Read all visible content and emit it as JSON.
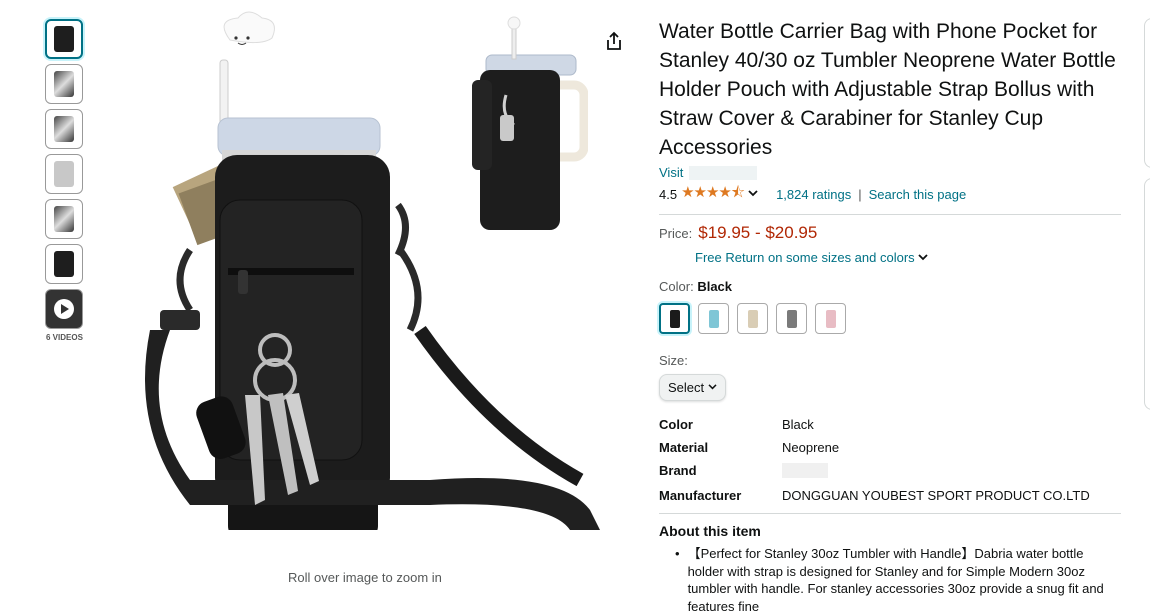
{
  "gallery": {
    "videos_label": "6 VIDEOS",
    "zoom_hint": "Roll over image to zoom in"
  },
  "product": {
    "title": "Water Bottle Carrier Bag with Phone Pocket for Stanley 40/30 oz Tumbler Neoprene Water Bottle Holder Pouch with Adjustable Strap Bollus with Straw Cover & Carabiner for Stanley Cup Accessories",
    "visit_label": "Visit",
    "rating_value": "4.5",
    "stars": "★★★★⯪",
    "ratings_count": "1,824 ratings",
    "search_page": "Search this page",
    "price_label": "Price:",
    "price": "$19.95 - $20.95",
    "free_return": "Free Return on some sizes and colors",
    "color_label": "Color:",
    "color_value": "Black",
    "size_label": "Size:",
    "size_select": "Select"
  },
  "swatch_colors": [
    "#1b1b1b",
    "#7fc6d6",
    "#d9cdb5",
    "#7a7a7a",
    "#e8bcc4"
  ],
  "specs": {
    "color": {
      "key": "Color",
      "value": "Black"
    },
    "material": {
      "key": "Material",
      "value": "Neoprene"
    },
    "brand": {
      "key": "Brand"
    },
    "manufacturer": {
      "key": "Manufacturer",
      "value": "DONGGUAN YOUBEST SPORT PRODUCT CO.LTD"
    }
  },
  "about": {
    "heading": "About this item",
    "bullet1": "【Perfect for Stanley 30oz Tumbler with Handle】Dabria water bottle holder with strap is designed for Stanley and for Simple Modern 30oz tumbler with handle. For stanley accessories 30oz provide a snug fit and features fine"
  },
  "icons": {
    "share": "share-icon",
    "chevron": "chevron-down-icon"
  }
}
